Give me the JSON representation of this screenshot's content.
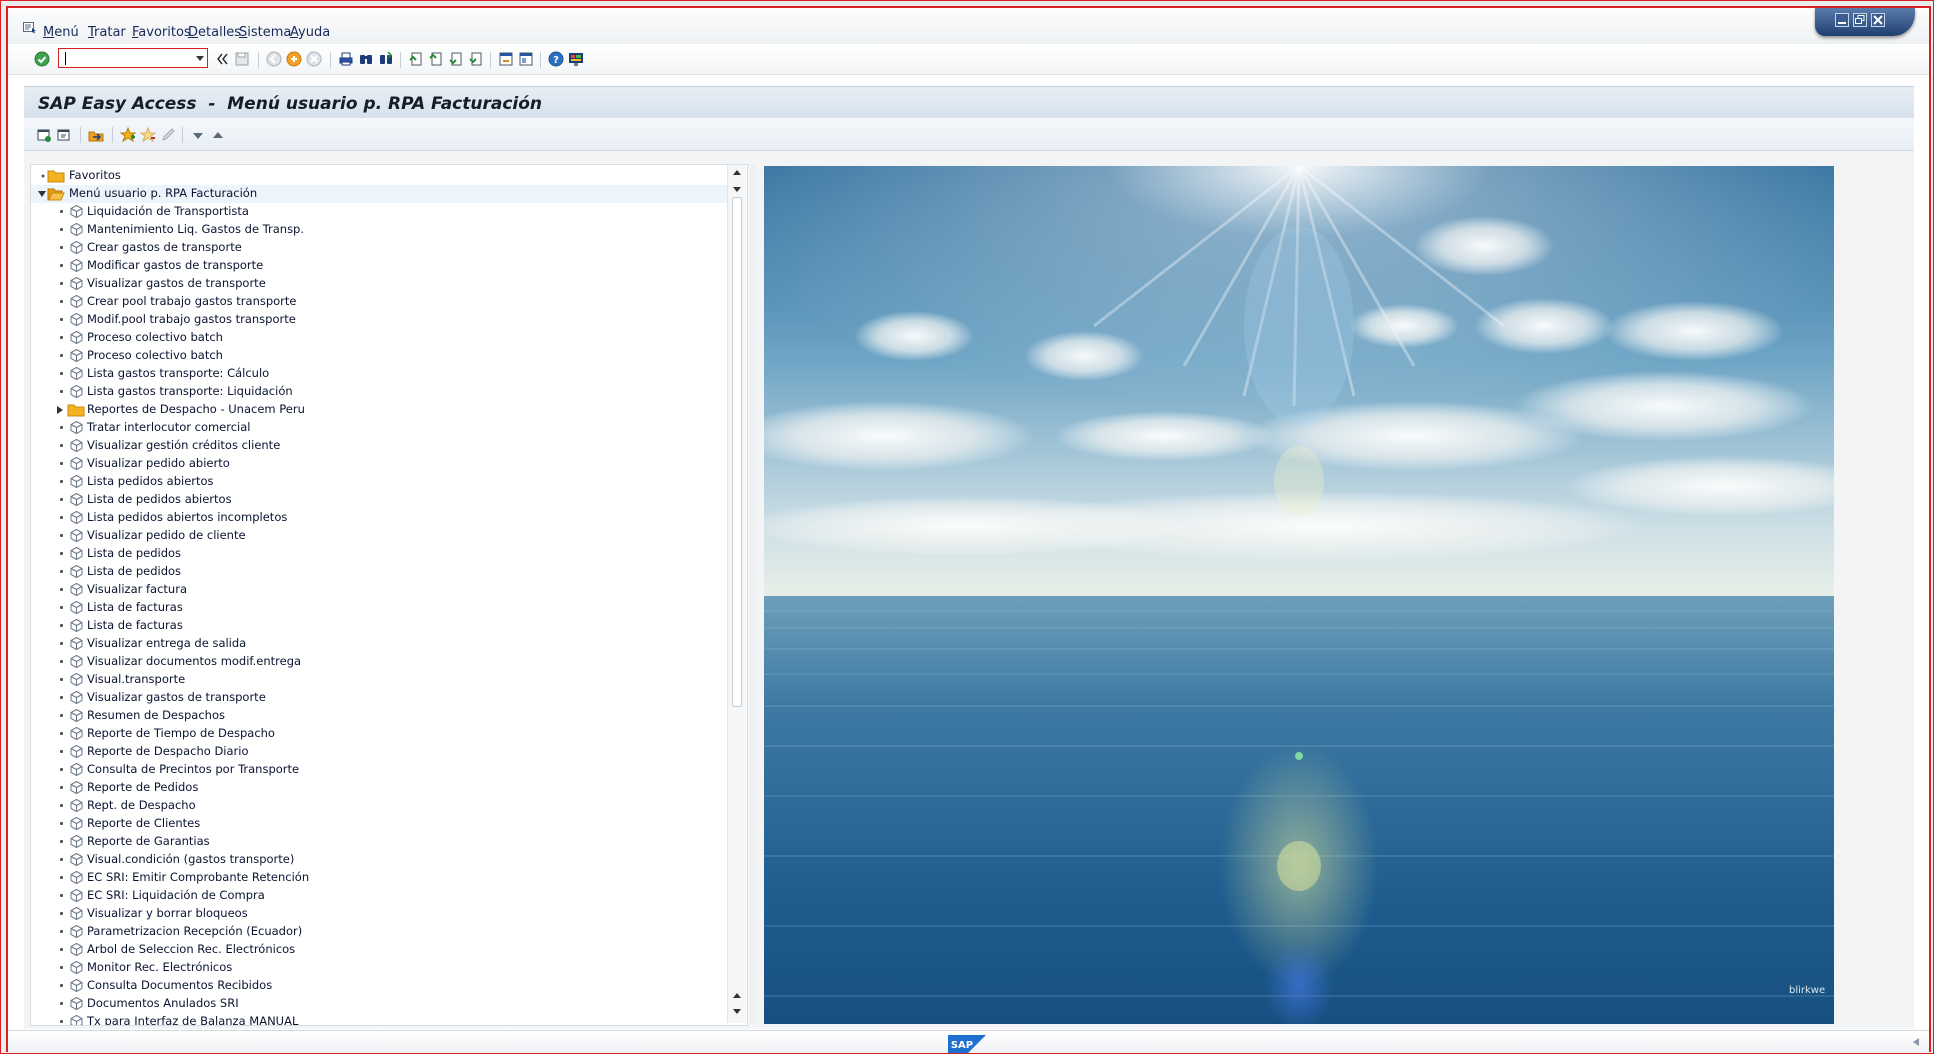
{
  "menu": {
    "items": [
      {
        "label": "Menú",
        "accel": "M"
      },
      {
        "label": "Tratar",
        "accel": "T"
      },
      {
        "label": "Favoritos",
        "accel": "F"
      },
      {
        "label": "Detalles",
        "accel": "D"
      },
      {
        "label": "Sistema",
        "accel": "S"
      },
      {
        "label": "Ayuda",
        "accel": "A"
      }
    ]
  },
  "toolbar": {
    "command_field": {
      "value": "",
      "placeholder": ""
    }
  },
  "header": {
    "title": "SAP Easy Access  -  Menú usuario p. RPA Facturación"
  },
  "tree": {
    "favorites": "Favoritos",
    "root": "Menú usuario p. RPA Facturación",
    "items": [
      "Liquidación de Transportista",
      "Mantenimiento Liq. Gastos de Transp.",
      "Crear gastos de transporte",
      "Modificar gastos de transporte",
      "Visualizar gastos de transporte",
      "Crear pool trabajo gastos transporte",
      "Modif.pool trabajo gastos transporte",
      "Proceso colectivo batch",
      "Proceso colectivo batch",
      "Lista gastos transporte: Cálculo",
      "Lista gastos transporte: Liquidación",
      "Reportes de Despacho - Unacem Peru",
      "Tratar interlocutor comercial",
      "Visualizar gestión créditos cliente",
      "Visualizar pedido abierto",
      "Lista pedidos abiertos",
      "Lista de pedidos abiertos",
      "Lista pedidos abiertos incompletos",
      "Visualizar pedido de cliente",
      "Lista de pedidos",
      "Lista de pedidos",
      "Visualizar factura",
      "Lista de facturas",
      "Lista de facturas",
      "Visualizar entrega de salida",
      "Visualizar documentos modif.entrega",
      "Visual.transporte",
      "Visualizar gastos de transporte",
      "Resumen de Despachos",
      "Reporte de Tiempo de Despacho",
      "Reporte de Despacho Diario",
      "Consulta de Precintos por Transporte",
      "Reporte de Pedidos",
      "Rept. de Despacho",
      "Reporte de Clientes",
      "Reporte de Garantias",
      "Visual.condición (gastos transporte)",
      "EC SRI: Emitir Comprobante Retención",
      "EC SRI: Liquidación de Compra",
      "Visualizar y borrar bloqueos",
      "Parametrizacion Recepción (Ecuador)",
      "Arbol de Seleccion Rec. Electrónicos",
      "Monitor Rec. Electrónicos",
      "Consulta Documentos Recibidos",
      "Documentos Anulados SRI",
      "Tx para Interfaz de Balanza MANUAL"
    ],
    "folder_item_index": 11
  },
  "image": {
    "watermark": "blirkwe"
  },
  "colors": {
    "frame_red": "#d82020",
    "title_bg": "#d6e1ec",
    "sky_top": "#2e6f9e",
    "sea": "#1f5f8f"
  },
  "footer": {
    "logo_text": "SAP"
  }
}
